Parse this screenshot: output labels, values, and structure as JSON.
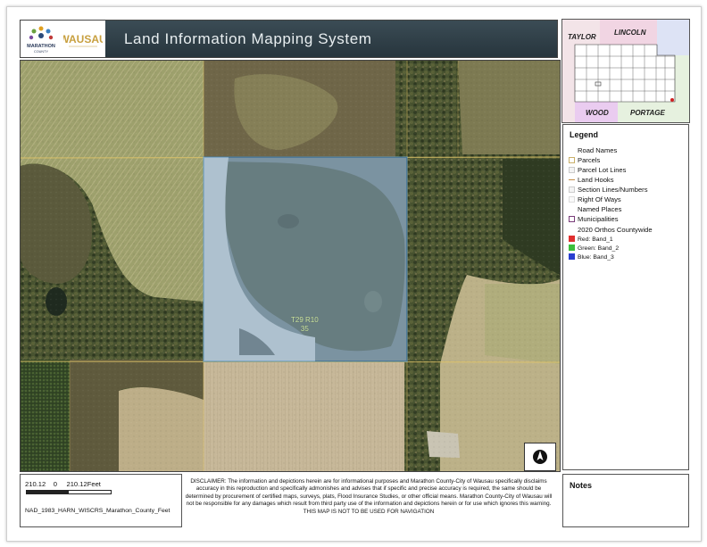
{
  "header": {
    "title": "Land Information Mapping System",
    "logo_left_text": "MARATHON COUNTY",
    "logo_right_text": "WAUSAU"
  },
  "map": {
    "parcel_label_line1": "T29 R10",
    "parcel_label_line2": "35",
    "imagery_colors": {
      "field_light": "#b7ad8d",
      "field_green": "#8e9467",
      "forest": "#3f4a2c",
      "selection_fill": "#b9d6ee",
      "selection_stroke": "#3b8fd6",
      "road": "#e2c66a"
    }
  },
  "locator": {
    "labels": [
      "TAYLOR",
      "LINCOLN",
      "WOOD",
      "PORTAGE"
    ]
  },
  "legend": {
    "title": "Legend",
    "items": [
      {
        "label": "Road Names",
        "swatch": "none"
      },
      {
        "label": "Parcels",
        "swatch": "#c9b06a"
      },
      {
        "label": "Parcel Lot Lines",
        "swatch": "#e6e6e6"
      },
      {
        "label": "Land Hooks",
        "swatch": "line"
      },
      {
        "label": "Section Lines/Numbers",
        "swatch": "#e6e6e6"
      },
      {
        "label": "Right Of Ways",
        "swatch": "#f0f0f0"
      },
      {
        "label": "Named Places",
        "swatch": "none"
      },
      {
        "label": "Municipalities",
        "swatch": "#7a3d7a"
      },
      {
        "label": "2020 Orthos Countywide",
        "swatch": "none"
      },
      {
        "label": "Red:   Band_1",
        "swatch": "#e03030"
      },
      {
        "label": "Green: Band_2",
        "swatch": "#3cbf3c"
      },
      {
        "label": "Blue:  Band_3",
        "swatch": "#2a3fd0"
      }
    ]
  },
  "scale": {
    "left": "210.12",
    "zero": "0",
    "right": "210.12Feet",
    "projection": "NAD_1983_HARN_WISCRS_Marathon_County_Feet"
  },
  "disclaimer": "DISCLAIMER: The information and depictions herein are for informational purposes and Marathon County-City of Wausau specifically disclaims accuracy in this reproduction and specifically admonishes and advises that if specific and precise accuracy is required, the same should be determined by procurement of certified maps, surveys, plats, Flood Insurance Studies, or other official means. Marathon County-City of Wausau will not be responsible for any damages which result from third party use of the information and depictions herein or for use which ignores this warning.",
  "disclaimer_last": "THIS MAP IS NOT TO BE USED FOR NAVIGATION",
  "notes": {
    "title": "Notes"
  }
}
